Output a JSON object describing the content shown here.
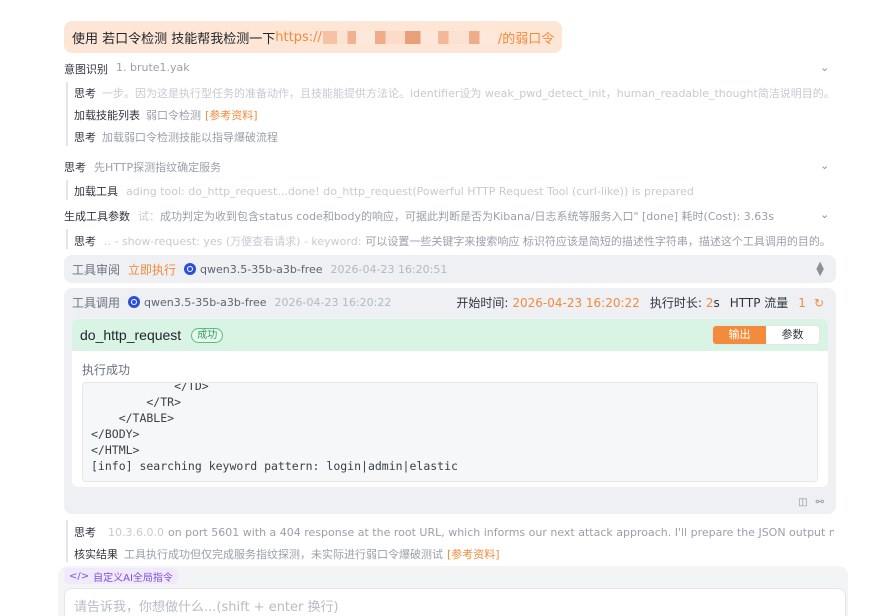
{
  "user_message": {
    "prefix": "使用 若口令检测 技能帮我检测一下",
    "link_start": "https://",
    "link_end": "/的弱口令"
  },
  "intent": {
    "label": "意图识别",
    "value": "1. brute1.yak",
    "items": [
      {
        "label": "思考",
        "text": "一步。因为这是执行型任务的准备动作，且技能能提供方法论。identifier设为 weak_pwd_detect_init，human_readable_thought简洁说明目的。"
      },
      {
        "label": "加载技能列表",
        "text": "弱口令检测",
        "ref": "[参考资料]"
      },
      {
        "label": "思考",
        "text": "加载弱口令检测技能以指导爆破流程"
      }
    ]
  },
  "think2": {
    "label": "思考",
    "value": "先HTTP探测指纹确定服务",
    "items": [
      {
        "label": "加载工具",
        "text": "ading tool: do_http_request...done! do_http_request(Powerful HTTP Request Tool (curl-like)) is prepared"
      }
    ]
  },
  "gen_params": {
    "label": "生成工具参数",
    "text": "成功判定为收到包含status code和body的响应，可据此判断是否为Kibana/日志系统等服务入口\" [done] 耗时(Cost): 3.63s",
    "faint_prefix": "试：",
    "items": [
      {
        "label": "思考",
        "faint": ".. - show-request: yes (万便查看请求) - keyword:",
        "text": "可以设置一些关键字来搜索响应 标识符应该是简短的描述性字符串，描述这个工具调用的目的。"
      }
    ]
  },
  "review": {
    "label": "工具审阅",
    "action": "立即执行",
    "model": "qwen3.5-35b-a3b-free",
    "timestamp": "2026-04-23 16:20:51"
  },
  "call": {
    "label": "工具调用",
    "model": "qwen3.5-35b-a3b-free",
    "timestamp": "2026-04-23 16:20:22",
    "start_label": "开始时间:",
    "start_value": "2026-04-23 16:20:22",
    "duration_label": "执行时长:",
    "duration_value": "2",
    "duration_unit": "s",
    "http_label": "HTTP 流量",
    "http_value": "1",
    "tool_name": "do_http_request",
    "status": "成功",
    "tabs": [
      "输出",
      "参数"
    ],
    "exec_status": "执行成功",
    "output": "            </TD>\n        </TR>\n    </TABLE>\n</BODY>\n</HTML>\n[info] searching keyword pattern: login|admin|elastic"
  },
  "after": [
    {
      "label": "思考",
      "faint": "10.3.6.0.0",
      "text": "on port 5601 with a 404 response at the root URL, which informs our next attack approach. I'll prepare the JSON output now."
    },
    {
      "label": "核实结果",
      "text": "工具执行成功但仅完成服务指纹探测，未实际进行弱口令爆破测试",
      "ref": "[参考资料]"
    }
  ],
  "composer": {
    "tag": "自定义AI全局指令",
    "placeholder": "请告诉我，你想做什么...(shift + enter 换行)"
  },
  "colors": {
    "accent": "#f28b3c",
    "success_bg": "#d9f3e4",
    "success": "#2f9e5a",
    "tag": "#7b4fd8"
  }
}
